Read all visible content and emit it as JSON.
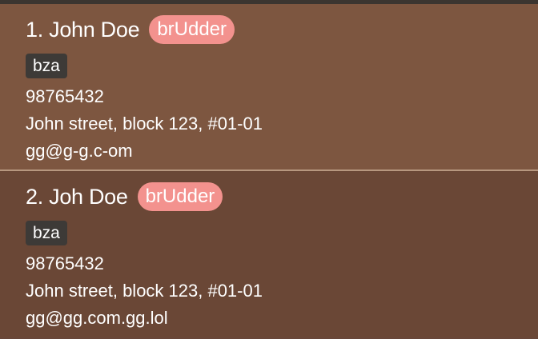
{
  "persons": [
    {
      "name": "1. John Doe",
      "role": "brUdder",
      "tag": "bza",
      "phone": "98765432",
      "address": "John street, block 123, #01-01",
      "email": "gg@g-g.c-om"
    },
    {
      "name": "2. Joh Doe",
      "role": "brUdder",
      "tag": "bza",
      "phone": "98765432",
      "address": "John street, block 123, #01-01",
      "email": "gg@gg.com.gg.lol"
    }
  ]
}
